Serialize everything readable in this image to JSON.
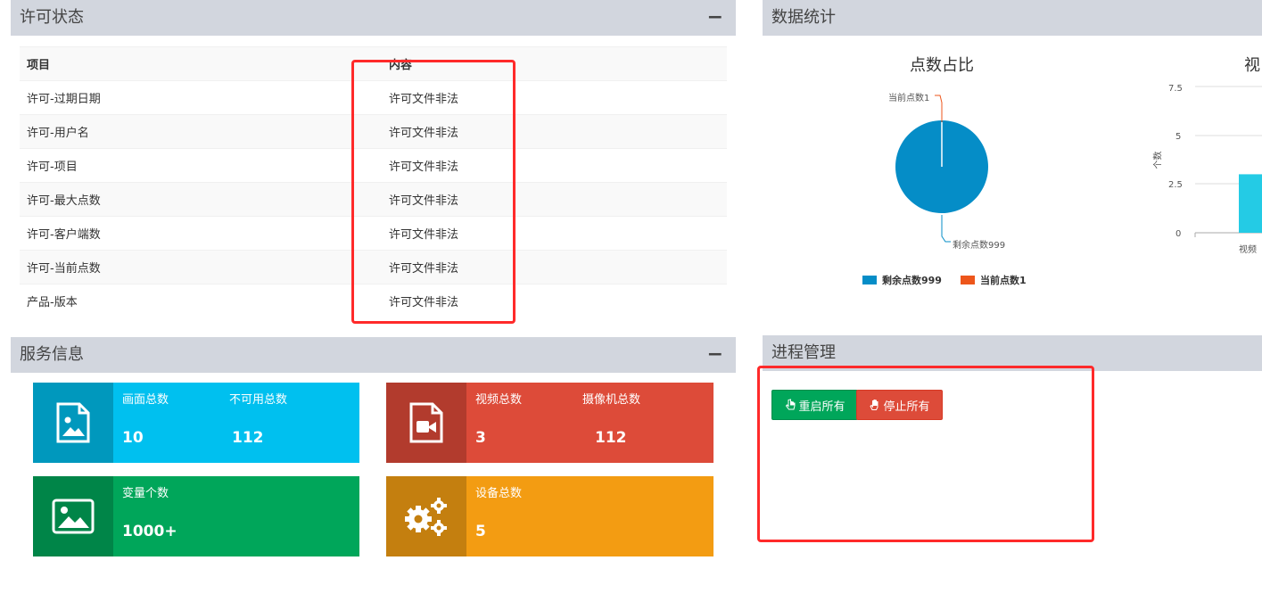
{
  "license": {
    "title": "许可状态",
    "collapse": "−",
    "headers": [
      "项目",
      "内容"
    ],
    "rows": [
      [
        "许可-过期日期",
        "许可文件非法"
      ],
      [
        "许可-用户名",
        "许可文件非法"
      ],
      [
        "许可-项目",
        "许可文件非法"
      ],
      [
        "许可-最大点数",
        "许可文件非法"
      ],
      [
        "许可-客户端数",
        "许可文件非法"
      ],
      [
        "许可-当前点数",
        "许可文件非法"
      ],
      [
        "产品-版本",
        "许可文件非法"
      ]
    ]
  },
  "stats": {
    "title": "数据统计",
    "pie_title": "点数占比",
    "bar_title_partial": "视",
    "yaxis_label": "个数",
    "xaxis_label_partial": "视频",
    "legend": [
      "剩余点数999",
      "当前点数1"
    ]
  },
  "service": {
    "title": "服务信息",
    "collapse": "−",
    "boxes": [
      {
        "labels": [
          "画面总数",
          "不可用总数"
        ],
        "values": [
          "10",
          "112"
        ],
        "color": "#00c0ef",
        "icon_color": "#0098bd"
      },
      {
        "labels": [
          "视频总数",
          "摄像机总数"
        ],
        "values": [
          "3",
          "112"
        ],
        "color": "#dd4b39",
        "icon_color": "#b23b2d"
      },
      {
        "labels": [
          "变量个数"
        ],
        "values": [
          "1000+"
        ],
        "color": "#00a65a",
        "icon_color": "#008548"
      },
      {
        "labels": [
          "设备总数"
        ],
        "values": [
          "5"
        ],
        "color": "#f39c12",
        "icon_color": "#c47f0f"
      }
    ]
  },
  "process": {
    "title": "进程管理",
    "restart_label": "重启所有",
    "stop_label": "停止所有"
  },
  "chart_data": [
    {
      "type": "pie",
      "title": "点数占比",
      "categories": [
        "剩余点数999",
        "当前点数1"
      ],
      "values": [
        999,
        1
      ],
      "colors": [
        "#058dc7",
        "#ed561b"
      ]
    },
    {
      "type": "bar",
      "title": "视",
      "ylabel": "个数",
      "categories": [
        "视频"
      ],
      "values": [
        3
      ],
      "ylim": [
        0,
        7.5
      ],
      "yticks": [
        0,
        2.5,
        5,
        7.5
      ],
      "colors": [
        "#24cbe5"
      ]
    }
  ]
}
